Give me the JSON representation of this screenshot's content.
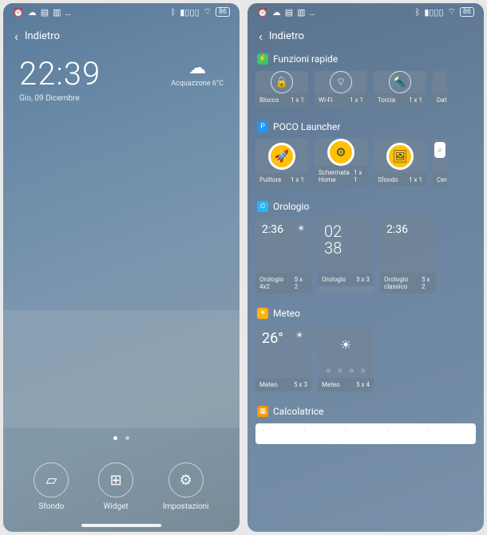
{
  "status": {
    "battery": "86"
  },
  "left": {
    "back_label": "Indietro",
    "clock": {
      "time": "22:39",
      "date": "Gio, 09 Dicembre"
    },
    "weather": {
      "label": "Acquazzone",
      "temp": "6°C"
    },
    "actions": {
      "sfondo": "Sfondo",
      "widget": "Widget",
      "impostazioni": "Impostazioni"
    }
  },
  "right": {
    "back_label": "Indietro",
    "sections": {
      "funzioni": {
        "title": "Funzioni rapide",
        "items": [
          {
            "name": "Blocco",
            "size": "1 x 1"
          },
          {
            "name": "Wi-Fi",
            "size": "1 x 1"
          },
          {
            "name": "Torcia",
            "size": "1 x 1"
          },
          {
            "name": "Dati",
            "size": ""
          }
        ]
      },
      "poco": {
        "title": "POCO Launcher",
        "items": [
          {
            "name": "Pulitore",
            "size": "1 x 1"
          },
          {
            "name": "Schermata Home",
            "size": "1 x 1"
          },
          {
            "name": "Sfondo",
            "size": "1 x 1"
          },
          {
            "name": "Cerca",
            "size": ""
          }
        ]
      },
      "orologio": {
        "title": "Orologio",
        "time": "2:36",
        "stack": {
          "l1": "02",
          "l2": "38"
        },
        "items": [
          {
            "name": "Orologio 4x2",
            "size": "5 x 2"
          },
          {
            "name": "Orologio",
            "size": "5 x 3"
          },
          {
            "name": "Orologio classico",
            "size": "5 x 2"
          }
        ]
      },
      "meteo": {
        "title": "Meteo",
        "temp": "26°",
        "items": [
          {
            "name": "Meteo",
            "size": "5 x 3"
          },
          {
            "name": "Meteo",
            "size": "5 x 4"
          }
        ]
      },
      "calcolatrice": {
        "title": "Calcolatrice"
      }
    }
  }
}
